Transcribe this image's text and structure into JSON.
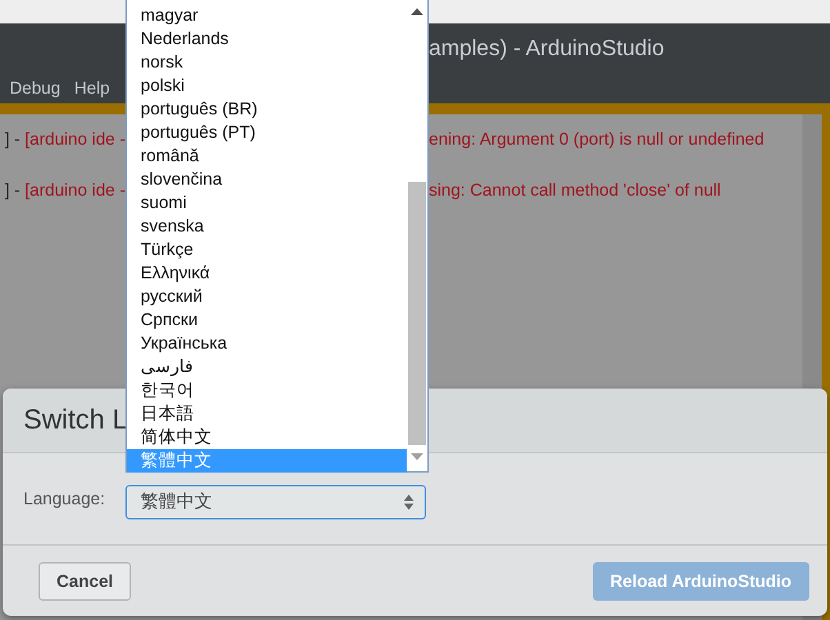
{
  "app": {
    "title": "amples) - ArduinoStudio",
    "menu": [
      "Debug",
      "Help"
    ],
    "console_lines": [
      {
        "prefix": "] - ",
        "source": "[arduino ide -",
        "message": "ening: Argument 0 (port) is null or undefined"
      },
      {
        "prefix": "] - ",
        "source": "[arduino ide -",
        "message": "sing: Cannot call method 'close' of null"
      }
    ]
  },
  "dialog": {
    "title": "Switch L",
    "language_label": "Language:",
    "language_value": "繁體中文",
    "buttons": [
      {
        "label": "Cancel",
        "kind": "secondary",
        "disabled": false
      },
      {
        "label": "Reload ArduinoStudio",
        "kind": "primary",
        "disabled": true
      }
    ]
  },
  "dropdown": {
    "options": [
      {
        "label": "magyar",
        "selected": false
      },
      {
        "label": "Nederlands",
        "selected": false
      },
      {
        "label": "norsk",
        "selected": false
      },
      {
        "label": "polski",
        "selected": false
      },
      {
        "label": "português (BR)",
        "selected": false
      },
      {
        "label": "português (PT)",
        "selected": false
      },
      {
        "label": "română",
        "selected": false
      },
      {
        "label": "slovenčina",
        "selected": false
      },
      {
        "label": "suomi",
        "selected": false
      },
      {
        "label": "svenska",
        "selected": false
      },
      {
        "label": "Türkçe",
        "selected": false
      },
      {
        "label": "Ελληνικά",
        "selected": false
      },
      {
        "label": "русский",
        "selected": false
      },
      {
        "label": "Српски",
        "selected": false
      },
      {
        "label": "Українська",
        "selected": false
      },
      {
        "label": "فارسی",
        "selected": false
      },
      {
        "label": "한국어",
        "selected": false
      },
      {
        "label": "日本語",
        "selected": false
      },
      {
        "label": "简体中文",
        "selected": false
      },
      {
        "label": "繁體中文",
        "selected": true
      }
    ]
  }
}
